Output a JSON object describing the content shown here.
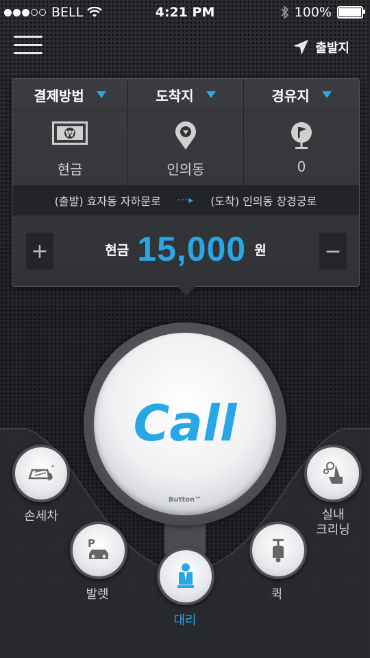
{
  "status_bar": {
    "carrier": "BELL",
    "time": "4:21 PM",
    "battery": "100%"
  },
  "header": {
    "depart_label": "출발지"
  },
  "options": [
    {
      "label": "결제방법",
      "value": "현금",
      "icon": "cash-icon"
    },
    {
      "label": "도착지",
      "value": "인의동",
      "icon": "map-pin-icon"
    },
    {
      "label": "경유지",
      "value": "0",
      "icon": "waypoint-flag-icon"
    }
  ],
  "route": {
    "from": "(출발) 효자동 자하문로",
    "to": "(도착) 인의동 창경궁로"
  },
  "fare": {
    "method": "현금",
    "amount": "15,000",
    "unit": "원",
    "plus": "+",
    "minus": "−"
  },
  "call": {
    "label": "Call",
    "sub": "Button™"
  },
  "services": {
    "car_wash": "손세차",
    "interior_cleaning_line1": "실내",
    "interior_cleaning_line2": "크리닝",
    "valet": "발렛",
    "quick": "퀵",
    "driver": "대리"
  },
  "colors": {
    "accent": "#28a7e6",
    "background": "#25272b"
  }
}
